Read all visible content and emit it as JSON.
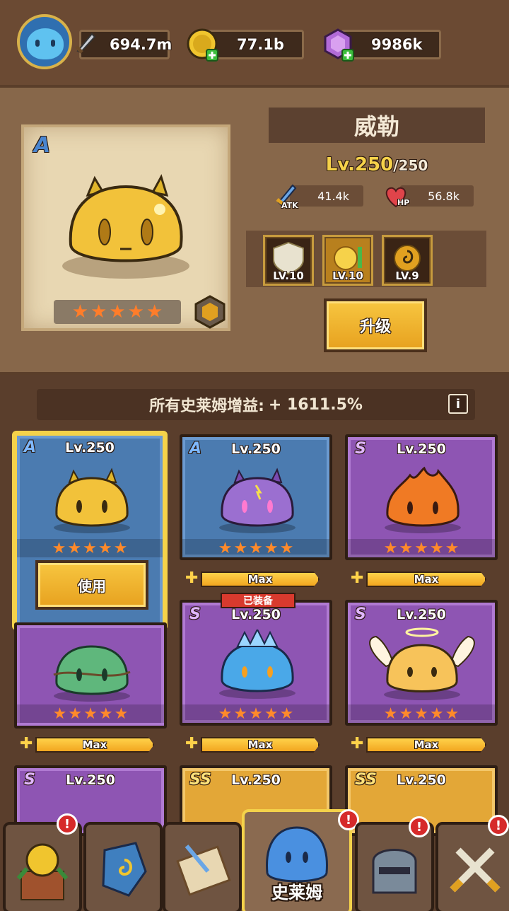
{
  "topbar": {
    "power": "694.7m",
    "coins": "77.1b",
    "gems": "9986k"
  },
  "hero": {
    "name": "威勒",
    "rank": "A",
    "level": "Lv.250",
    "max_level": "/250",
    "atk_label": "ATK",
    "atk": "41.4k",
    "hp_label": "HP",
    "hp": "56.8k",
    "stars": 5,
    "skills": [
      {
        "icon": "shield-skill-icon",
        "level": "LV.10"
      },
      {
        "icon": "coin-skill-icon",
        "level": "LV.10"
      },
      {
        "icon": "swirl-skill-icon",
        "level": "LV.9"
      }
    ],
    "upgrade_label": "升级"
  },
  "banner": {
    "text": "所有史莱姆增益:",
    "value": "+ 1611.5%",
    "info": "i"
  },
  "slimes": [
    {
      "rank": "A",
      "level": "Lv.250",
      "color": "#f2c23a",
      "frame": "blue",
      "action": "使用"
    },
    {
      "rank": "A",
      "level": "Lv.250",
      "color": "#9b6fd0",
      "frame": "blue",
      "max": "Max"
    },
    {
      "rank": "S",
      "level": "Lv.250",
      "color": "#f07a24",
      "frame": "purple",
      "max": "Max"
    },
    {
      "rank": "",
      "level": "",
      "color": "#5fb77c",
      "frame": "purple",
      "max": "Max"
    },
    {
      "rank": "S",
      "level": "Lv.250",
      "color": "#4aa8e8",
      "frame": "purple",
      "max": "Max",
      "tag": "已装备"
    },
    {
      "rank": "S",
      "level": "Lv.250",
      "color": "#f7c35a",
      "frame": "purple",
      "max": "Max"
    },
    {
      "rank": "S",
      "level": "Lv.250",
      "color": "#7a3a6a",
      "frame": "purple"
    },
    {
      "rank": "SS",
      "level": "Lv.250",
      "color": "#6a4a8a",
      "frame": "gold"
    },
    {
      "rank": "SS",
      "level": "Lv.250",
      "color": "#3a5a8a",
      "frame": "gold"
    }
  ],
  "nav": {
    "active_label": "史莱姆",
    "alert": "!"
  }
}
